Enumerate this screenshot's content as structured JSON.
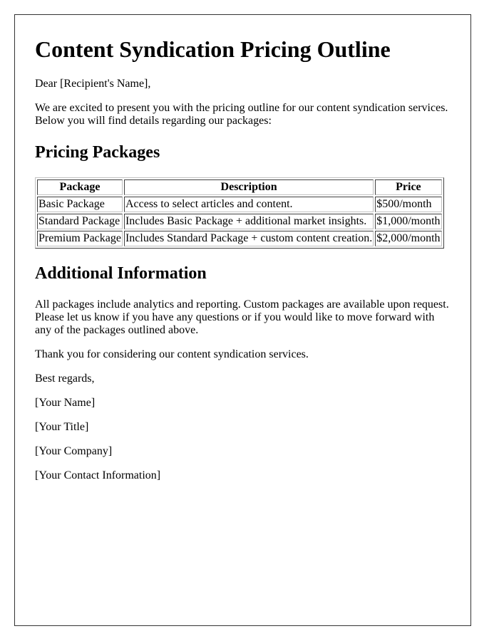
{
  "document": {
    "title": "Content Syndication Pricing Outline",
    "greeting": "Dear [Recipient's Name],",
    "intro": "We are excited to present you with the pricing outline for our content syndication services. Below you will find details regarding our packages:",
    "pricing_section": {
      "heading": "Pricing Packages",
      "columns": [
        "Package",
        "Description",
        "Price"
      ],
      "rows": [
        {
          "package": "Basic Package",
          "description": "Access to select articles and content.",
          "price": "$500/month"
        },
        {
          "package": "Standard Package",
          "description": "Includes Basic Package + additional market insights.",
          "price": "$1,000/month"
        },
        {
          "package": "Premium Package",
          "description": "Includes Standard Package + custom content creation.",
          "price": "$2,000/month"
        }
      ]
    },
    "additional_section": {
      "heading": "Additional Information",
      "body": "All packages include analytics and reporting. Custom packages are available upon request. Please let us know if you have any questions or if you would like to move forward with any of the packages outlined above."
    },
    "thanks": "Thank you for considering our content syndication services.",
    "closing": "Best regards,",
    "signature": {
      "name": "[Your Name]",
      "title": "[Your Title]",
      "company": "[Your Company]",
      "contact": "[Your Contact Information]"
    }
  }
}
